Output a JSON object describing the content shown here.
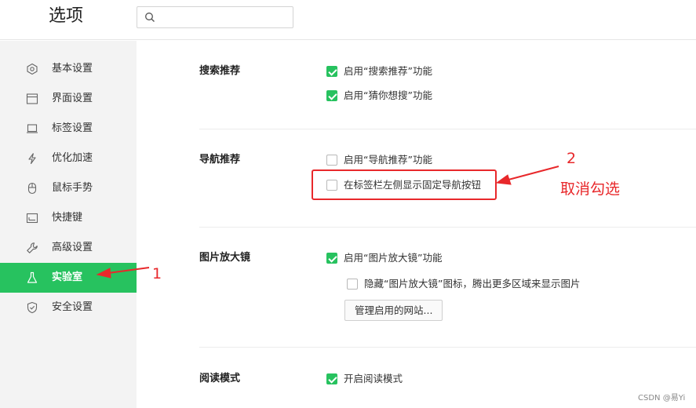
{
  "header": {
    "title": "选项",
    "search": {
      "placeholder": "",
      "icon": "search-icon"
    }
  },
  "sidebar": {
    "items": [
      {
        "label": "基本设置",
        "icon": "hexagon-settings-icon"
      },
      {
        "label": "界面设置",
        "icon": "window-icon"
      },
      {
        "label": "标签设置",
        "icon": "tab-icon"
      },
      {
        "label": "优化加速",
        "icon": "lightning-icon"
      },
      {
        "label": "鼠标手势",
        "icon": "mouse-icon"
      },
      {
        "label": "快捷键",
        "icon": "keyboard-icon"
      },
      {
        "label": "高级设置",
        "icon": "wrench-icon"
      },
      {
        "label": "实验室",
        "icon": "flask-icon",
        "active": true
      },
      {
        "label": "安全设置",
        "icon": "shield-icon"
      }
    ]
  },
  "sections": {
    "search_rec": {
      "title": "搜索推荐",
      "options": [
        {
          "label": "启用“搜索推荐”功能",
          "checked": true
        },
        {
          "label": "启用“猜你想搜”功能",
          "checked": true
        }
      ]
    },
    "nav_rec": {
      "title": "导航推荐",
      "options": [
        {
          "label": "启用“导航推荐”功能",
          "checked": false
        },
        {
          "label": "在标签栏左侧显示固定导航按钮",
          "checked": false
        }
      ]
    },
    "magnifier": {
      "title": "图片放大镜",
      "options": [
        {
          "label": "启用“图片放大镜”功能",
          "checked": true
        },
        {
          "label": "隐藏“图片放大镜”图标，腾出更多区域来显示图片",
          "checked": false
        }
      ],
      "button": "管理启用的网站..."
    },
    "reading": {
      "title": "阅读模式",
      "options": [
        {
          "label": "开启阅读模式",
          "checked": true
        }
      ]
    }
  },
  "annotations": {
    "num1": "1",
    "num2": "2",
    "text": "取消勾选",
    "color": "#e8282b"
  },
  "accent_color": "#27c25f",
  "watermark": "CSDN @易Yi"
}
